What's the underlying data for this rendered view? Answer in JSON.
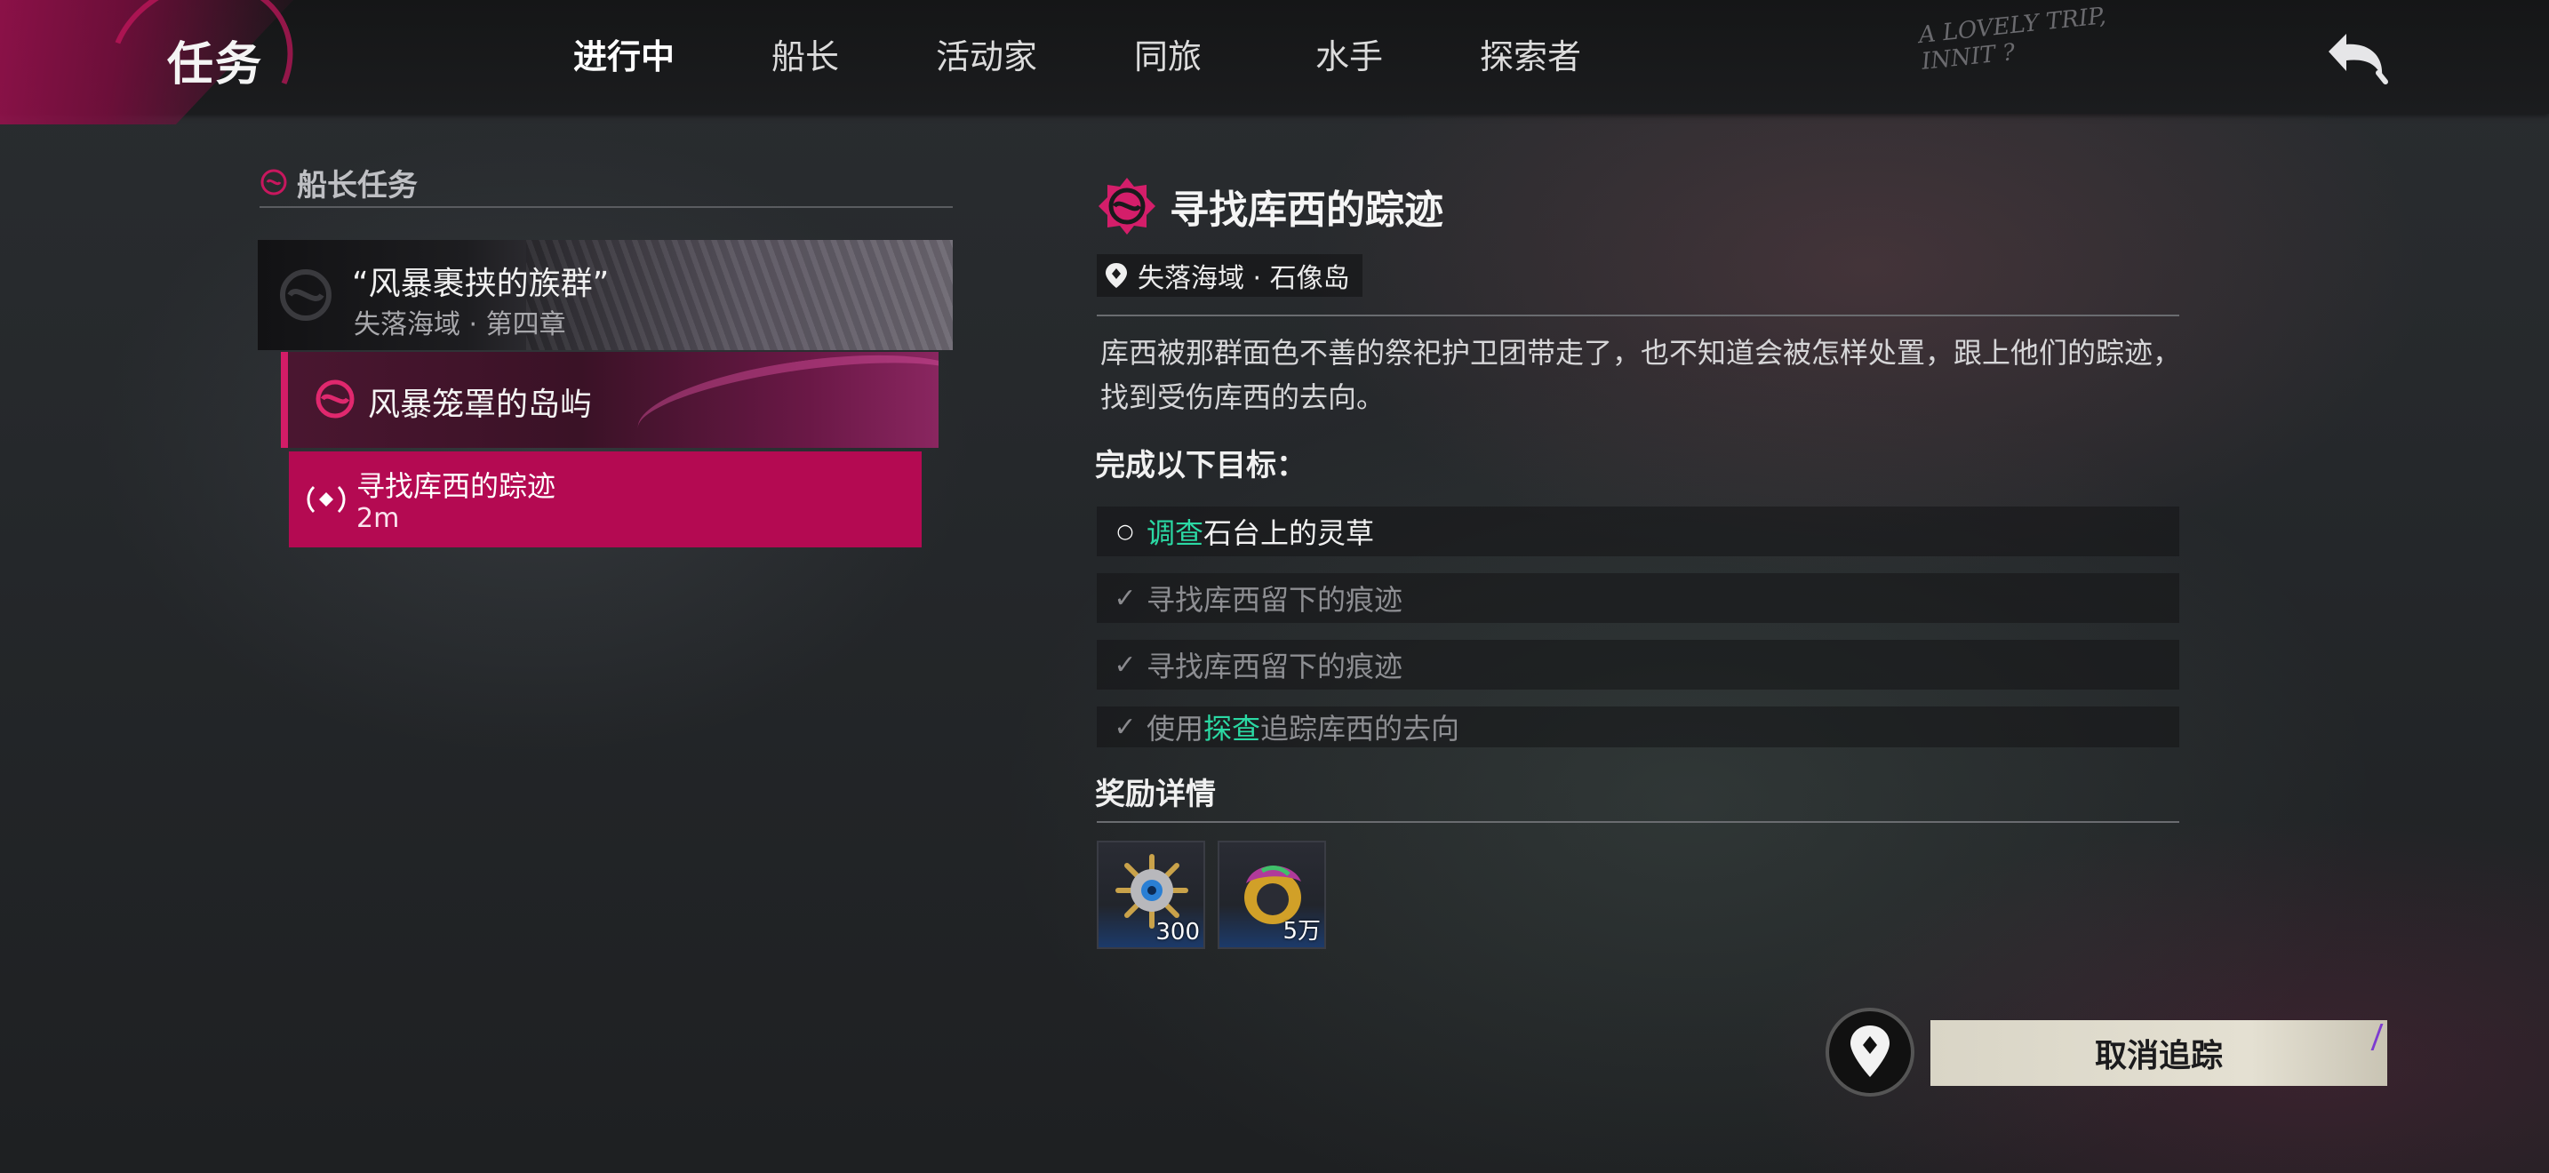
{
  "header": {
    "title": "任务",
    "tabs": [
      {
        "label": "进行中",
        "active": true
      },
      {
        "label": "船长",
        "active": false
      },
      {
        "label": "活动家",
        "active": false
      },
      {
        "label": "同旅",
        "active": false
      },
      {
        "label": "水手",
        "active": false
      },
      {
        "label": "探索者",
        "active": false
      }
    ],
    "handwrite_line1": "A LOVELY TRIP,",
    "handwrite_line2": "INNIT ?",
    "back_icon": "return-arrow-icon"
  },
  "colors": {
    "accent": "#c8175e",
    "active_quest": "#b40a52",
    "highlight": "#2bd9a4",
    "button": "#e0dccd"
  },
  "left_panel": {
    "section_title": "船长任务",
    "chapter": {
      "title": "“风暴裹挟的族群”",
      "subtitle": "失落海域 · 第四章"
    },
    "quest": {
      "title": "风暴笼罩的岛屿"
    },
    "subquest": {
      "title": "寻找库西的踪迹",
      "distance": "2m"
    }
  },
  "detail": {
    "title": "寻找库西的踪迹",
    "location": "失落海域 · 石像岛",
    "description": "库西被那群面色不善的祭祀护卫团带走了，也不知道会被怎样处置，跟上他们的踪迹，找到受伤库西的去向。",
    "objectives_heading": "完成以下目标：",
    "objectives": [
      {
        "mark": "○",
        "highlight": "调查",
        "text": "石台上的灵草",
        "state": "current"
      },
      {
        "mark": "✓",
        "prefix": "",
        "text": "寻找库西留下的痕迹",
        "state": "done"
      },
      {
        "mark": "✓",
        "prefix": "",
        "text": "寻找库西留下的痕迹",
        "state": "done"
      },
      {
        "mark": "✓",
        "prefix": "使用",
        "highlight": "探查",
        "text": "追踪库西的去向",
        "state": "done"
      }
    ],
    "rewards_heading": "奖励详情",
    "rewards": [
      {
        "icon": "ship-wheel-badge-icon",
        "count": "300"
      },
      {
        "icon": "gold-coin-ring-icon",
        "count": "5万"
      }
    ]
  },
  "footer": {
    "track_icon": "map-pin-icon",
    "untrack_label": "取消追踪"
  }
}
